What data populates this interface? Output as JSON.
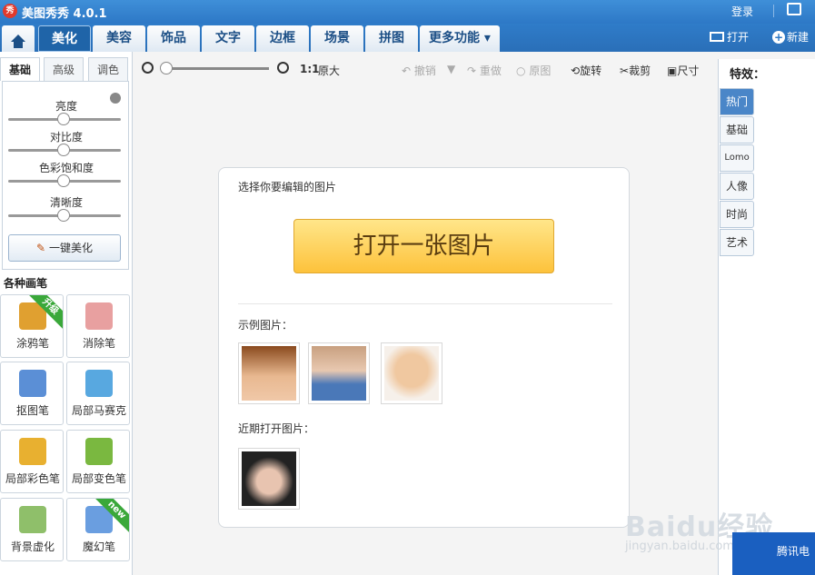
{
  "app": {
    "title": "美图秀秀 4.0.1",
    "logo_text": "秀",
    "login": "登录"
  },
  "tabs": [
    {
      "label": "美化",
      "active": true
    },
    {
      "label": "美容"
    },
    {
      "label": "饰品"
    },
    {
      "label": "文字"
    },
    {
      "label": "边框"
    },
    {
      "label": "场景"
    },
    {
      "label": "拼图"
    },
    {
      "label": "更多功能 ▾"
    }
  ],
  "toolbar_right": {
    "open": "打开",
    "new": "新建"
  },
  "canvas_toolbar": {
    "ratio": "1:1",
    "original_size": "原大",
    "undo": "撤销",
    "redo": "重做",
    "original": "原图",
    "rotate": "旋转",
    "crop": "裁剪",
    "size": "尺寸"
  },
  "left_panel": {
    "subtabs": [
      "基础",
      "高级",
      "调色"
    ],
    "sliders": [
      {
        "label": "亮度",
        "value": 0.5
      },
      {
        "label": "对比度",
        "value": 0.5
      },
      {
        "label": "色彩饱和度",
        "value": 0.5
      },
      {
        "label": "清晰度",
        "value": 0.5
      }
    ],
    "one_click": "一键美化",
    "brush_title": "各种画笔",
    "brushes": [
      {
        "label": "涂鸦笔",
        "badge": "升级",
        "icon": "pencil-icon",
        "color": "#e0a030"
      },
      {
        "label": "消除笔",
        "icon": "eraser-icon",
        "color": "#e8a0a0"
      },
      {
        "label": "抠图笔",
        "icon": "cutout-pen-icon",
        "color": "#5b8fd6"
      },
      {
        "label": "局部马赛克",
        "icon": "mosaic-icon",
        "color": "#58a8e0"
      },
      {
        "label": "局部彩色笔",
        "icon": "color-brush-icon",
        "color": "#e8b030"
      },
      {
        "label": "局部变色笔",
        "icon": "recolor-brush-icon",
        "color": "#7ab840"
      },
      {
        "label": "背景虚化",
        "icon": "blur-background-icon",
        "color": "#8fbf6a"
      },
      {
        "label": "魔幻笔",
        "badge": "new",
        "icon": "magic-pen-icon",
        "color": "#6a9ee0"
      }
    ]
  },
  "right_panel": {
    "title": "特效：",
    "tabs": [
      "热门",
      "基础",
      "Lomo",
      "人像",
      "时尚",
      "艺术"
    ]
  },
  "center": {
    "choose_label": "选择你要编辑的图片",
    "open_button": "打开一张图片",
    "samples_label": "示例图片：",
    "recent_label": "近期打开图片："
  },
  "watermark": {
    "text": "Baidu经验",
    "url": "jingyan.baidu.com"
  },
  "corner_ad": {
    "text": "腾讯电"
  }
}
